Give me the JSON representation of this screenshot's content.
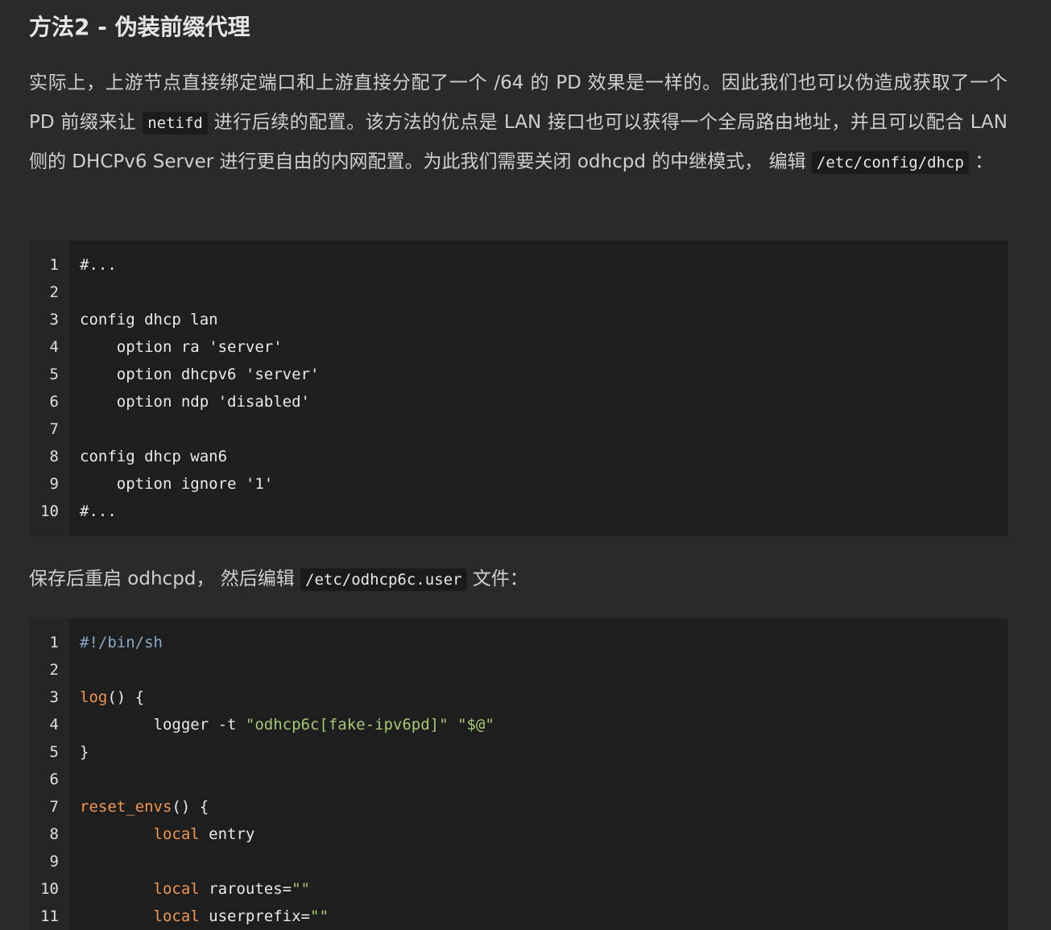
{
  "heading": "方法2 - 伪装前缀代理",
  "para1": {
    "t1": "实际上，上游节点直接绑定端口和上游直接分配了一个 /64 的 PD 效果是一样的。因此我们也可以伪造成获取了一个 PD 前缀来让 ",
    "code1": "netifd",
    "t2": " 进行后续的配置。该方法的优点是 LAN 接口也可以获得一个全局路由地址，并且可以配合 LAN 侧的 DHCPv6 Server 进行更自由的内网配置。为此我们需要关闭 odhcpd 的中继模式， 编辑 ",
    "code2": "/etc/config/dhcp",
    "t3": " ："
  },
  "code_block_1": {
    "lines": [
      {
        "n": "1",
        "text": "#..."
      },
      {
        "n": "2",
        "text": ""
      },
      {
        "n": "3",
        "text": "config dhcp lan"
      },
      {
        "n": "4",
        "text": "    option ra 'server'"
      },
      {
        "n": "5",
        "text": "    option dhcpv6 'server'"
      },
      {
        "n": "6",
        "text": "    option ndp 'disabled'"
      },
      {
        "n": "7",
        "text": ""
      },
      {
        "n": "8",
        "text": "config dhcp wan6"
      },
      {
        "n": "9",
        "text": "    option ignore '1'"
      },
      {
        "n": "10",
        "text": "#..."
      }
    ]
  },
  "para2": {
    "t1": "保存后重启 odhcpd， 然后编辑 ",
    "code1": "/etc/odhcp6c.user",
    "t2": " 文件："
  },
  "code_block_2": {
    "lines": [
      {
        "n": "1",
        "tokens": [
          {
            "c": "cmt",
            "t": "#!/bin/sh"
          }
        ]
      },
      {
        "n": "2",
        "tokens": []
      },
      {
        "n": "3",
        "tokens": [
          {
            "c": "kw",
            "t": "log"
          },
          {
            "c": "",
            "t": "() {"
          }
        ]
      },
      {
        "n": "4",
        "tokens": [
          {
            "c": "",
            "t": "        logger -t "
          },
          {
            "c": "str",
            "t": "\"odhcp6c[fake-ipv6pd]\""
          },
          {
            "c": "",
            "t": " "
          },
          {
            "c": "str",
            "t": "\"$@\""
          }
        ]
      },
      {
        "n": "5",
        "tokens": [
          {
            "c": "",
            "t": "}"
          }
        ]
      },
      {
        "n": "6",
        "tokens": []
      },
      {
        "n": "7",
        "tokens": [
          {
            "c": "kw",
            "t": "reset_envs"
          },
          {
            "c": "",
            "t": "() {"
          }
        ]
      },
      {
        "n": "8",
        "tokens": [
          {
            "c": "",
            "t": "        "
          },
          {
            "c": "kw",
            "t": "local"
          },
          {
            "c": "",
            "t": " entry"
          }
        ]
      },
      {
        "n": "9",
        "tokens": []
      },
      {
        "n": "10",
        "tokens": [
          {
            "c": "",
            "t": "        "
          },
          {
            "c": "kw",
            "t": "local"
          },
          {
            "c": "",
            "t": " raroutes="
          },
          {
            "c": "str",
            "t": "\"\""
          }
        ]
      },
      {
        "n": "11",
        "tokens": [
          {
            "c": "",
            "t": "        "
          },
          {
            "c": "kw",
            "t": "local"
          },
          {
            "c": "",
            "t": " userprefix="
          },
          {
            "c": "str",
            "t": "\"\""
          }
        ]
      }
    ]
  },
  "colors": {
    "background": "#2a2a2a",
    "code_background": "#1e1e1e",
    "gutter_background": "#252525",
    "keyword": "#f0964e",
    "string": "#a6c872",
    "comment": "#8aa8c9"
  }
}
